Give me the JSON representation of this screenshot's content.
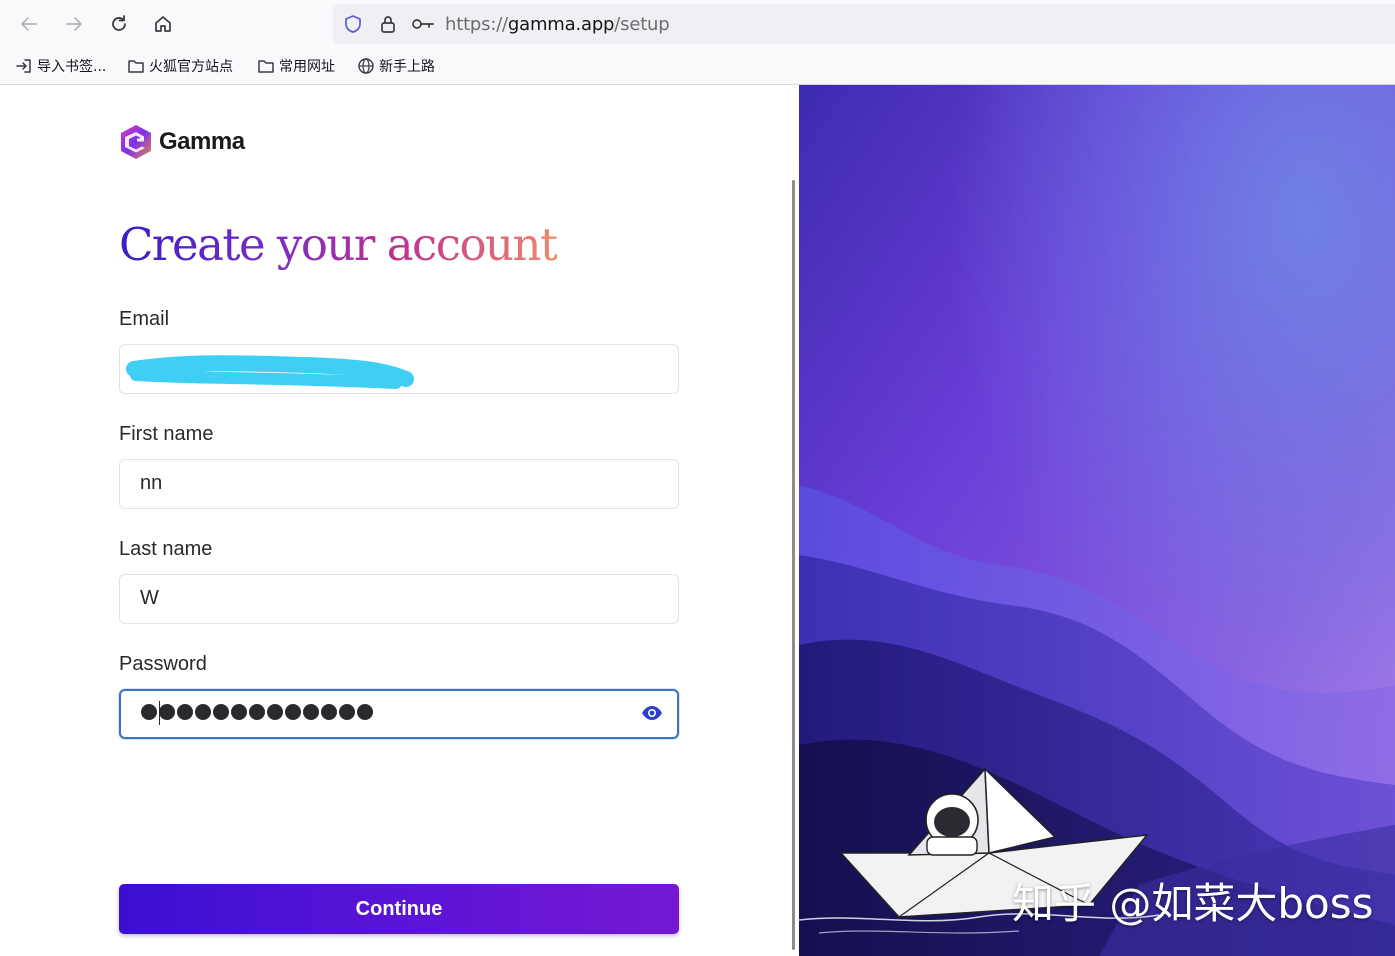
{
  "browser": {
    "url_scheme": "https://",
    "url_host": "gamma.app",
    "url_path": "/setup",
    "bookmarks": [
      {
        "label": "导入书签...",
        "icon": "import-icon"
      },
      {
        "label": "火狐官方站点",
        "icon": "folder-icon"
      },
      {
        "label": "常用网址",
        "icon": "folder-icon"
      },
      {
        "label": "新手上路",
        "icon": "globe-icon"
      }
    ]
  },
  "page": {
    "brand": "Gamma",
    "title": "Create your account",
    "email_label": "Email",
    "email_value": "",
    "first_name_label": "First name",
    "first_name_value": "nn",
    "last_name_label": "Last name",
    "last_name_value": "W",
    "password_label": "Password",
    "password_mask_count": 13,
    "continue_label": "Continue",
    "watermark": "知乎 @如菜大boss"
  },
  "colors": {
    "accent": "#3a74c4",
    "button_start": "#3a0fd1",
    "button_end": "#7418d2",
    "email_redaction": "#3fcff5"
  }
}
